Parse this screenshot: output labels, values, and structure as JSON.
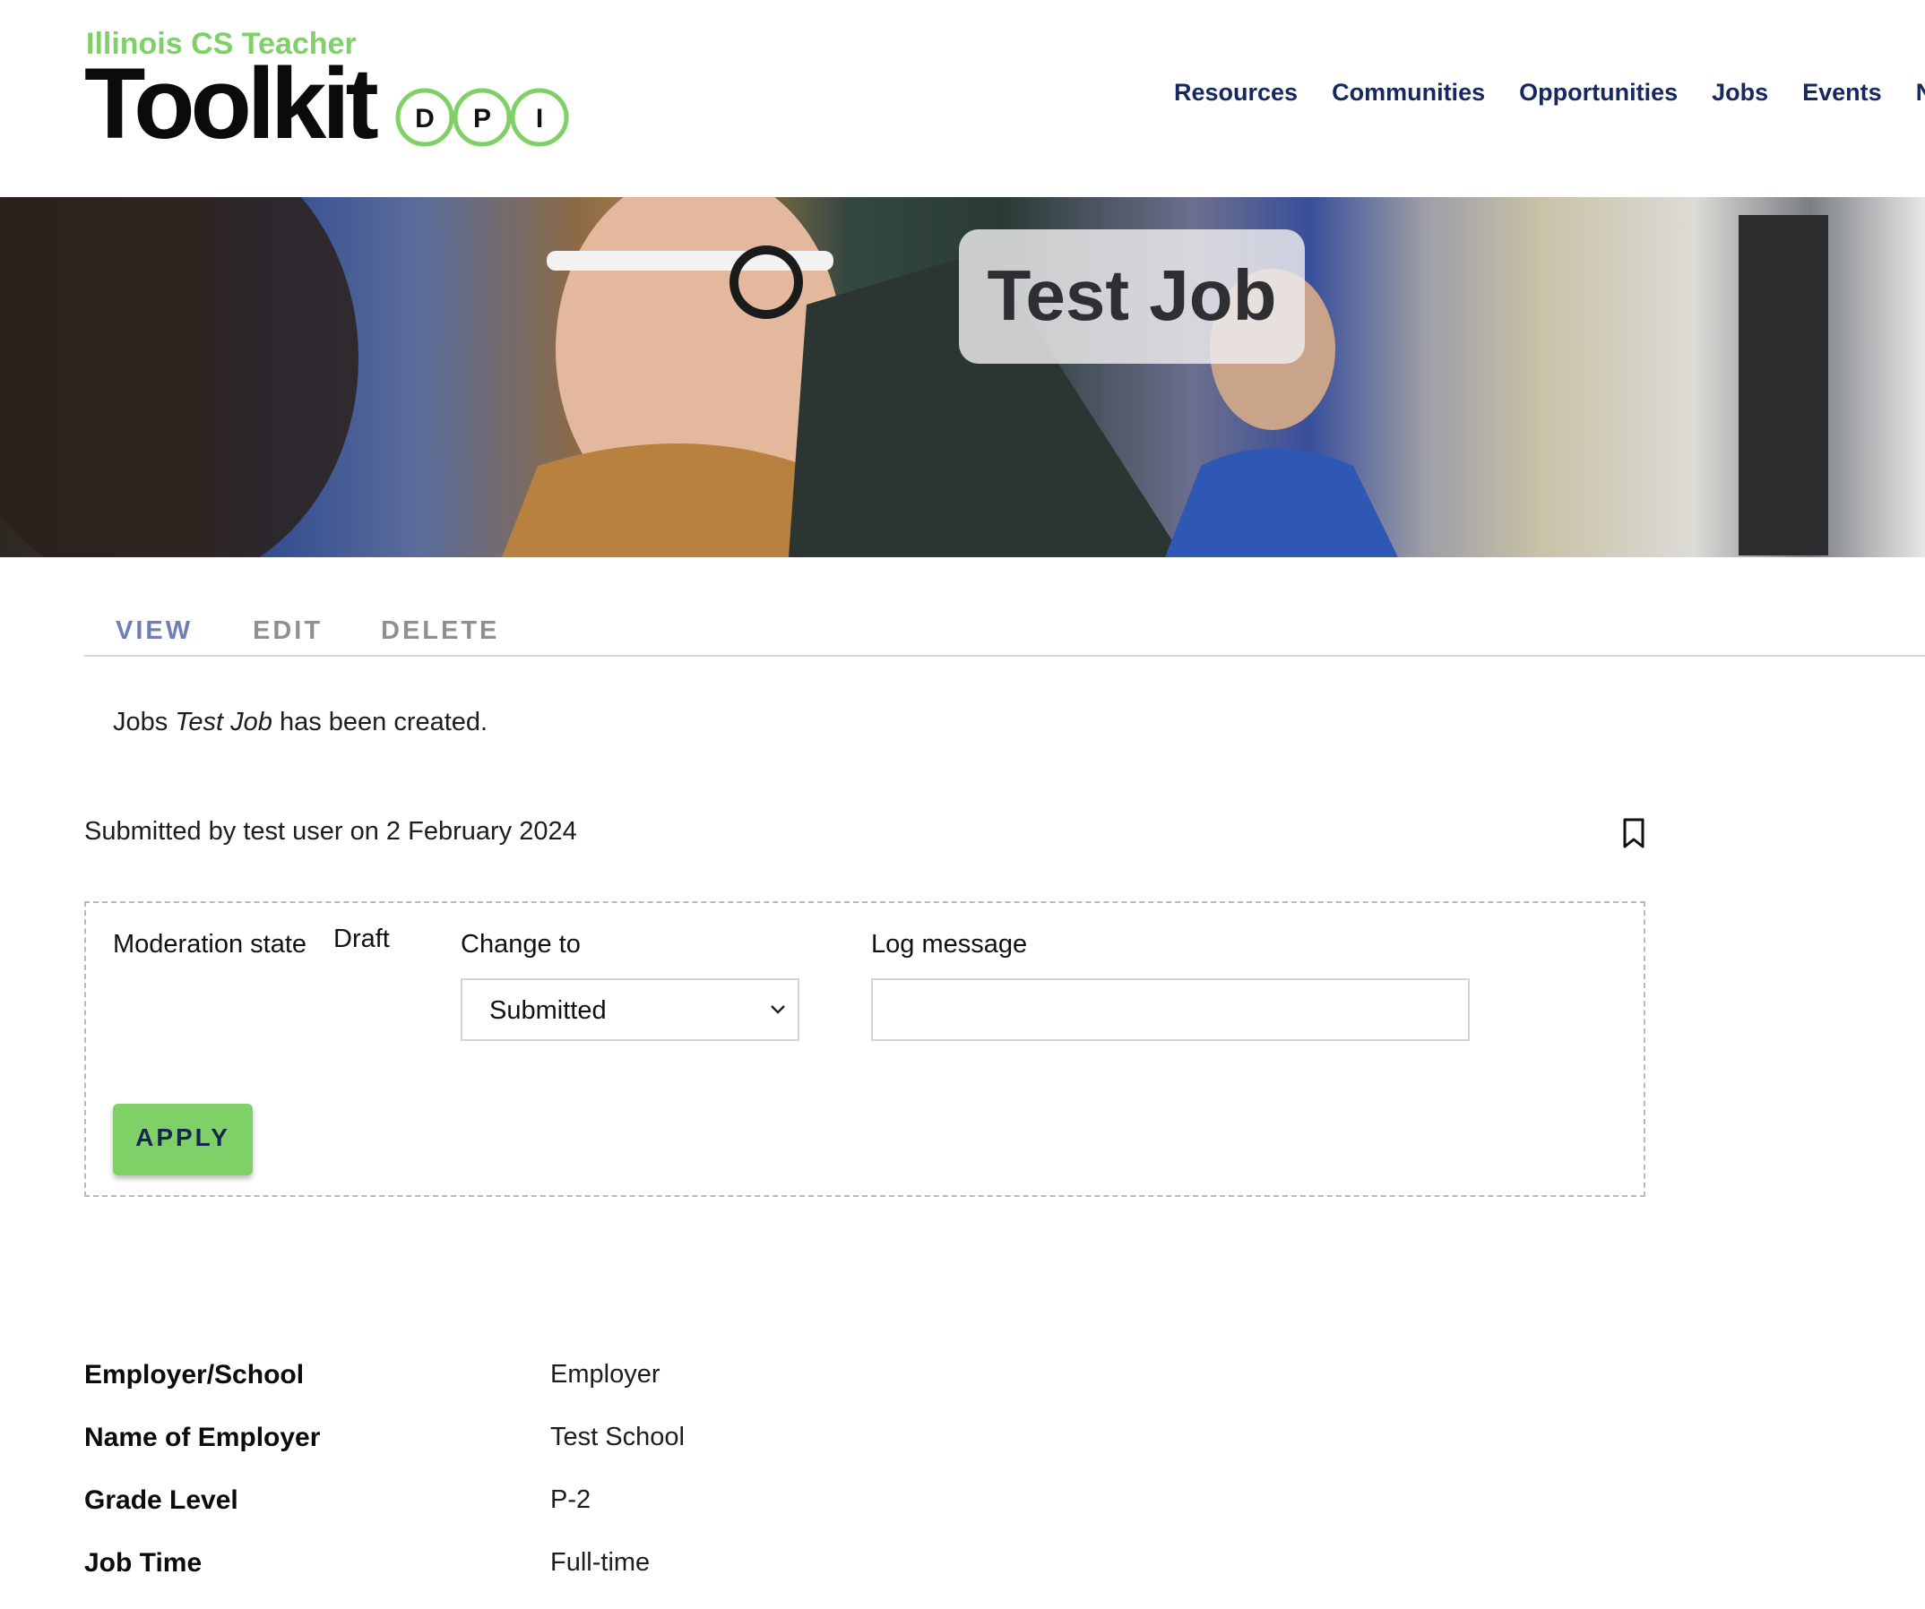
{
  "header": {
    "logo_sub": "Illinois CS Teacher",
    "logo_main": "Toolkit",
    "logo_letters": [
      "D",
      "P",
      "I"
    ],
    "brand_green": "#7ed067",
    "nav": [
      "Resources",
      "Communities",
      "Opportunities",
      "Jobs",
      "Events",
      "Ne"
    ],
    "nav_color": "#16285e"
  },
  "hero": {
    "title": "Test Job"
  },
  "tabs": {
    "view": "VIEW",
    "edit": "EDIT",
    "delete": "DELETE"
  },
  "status": {
    "prefix": "Jobs ",
    "item": "Test Job",
    "suffix": " has been created."
  },
  "submitted": {
    "prefix": "Submitted by ",
    "user": "test user",
    "suffix": " on 2 February 2024",
    "icon": "bookmark-icon"
  },
  "moderation": {
    "label": "Moderation state",
    "state": "Draft",
    "change_label": "Change to",
    "change_value": "Submitted",
    "log_label": "Log message",
    "log_value": "",
    "apply_label": "APPLY"
  },
  "fields": [
    {
      "label": "Employer/School",
      "value": "Employer"
    },
    {
      "label": "Name of Employer",
      "value": "Test School"
    },
    {
      "label": "Grade Level",
      "value": "P-2"
    },
    {
      "label": "Job Time",
      "value": "Full-time"
    }
  ]
}
